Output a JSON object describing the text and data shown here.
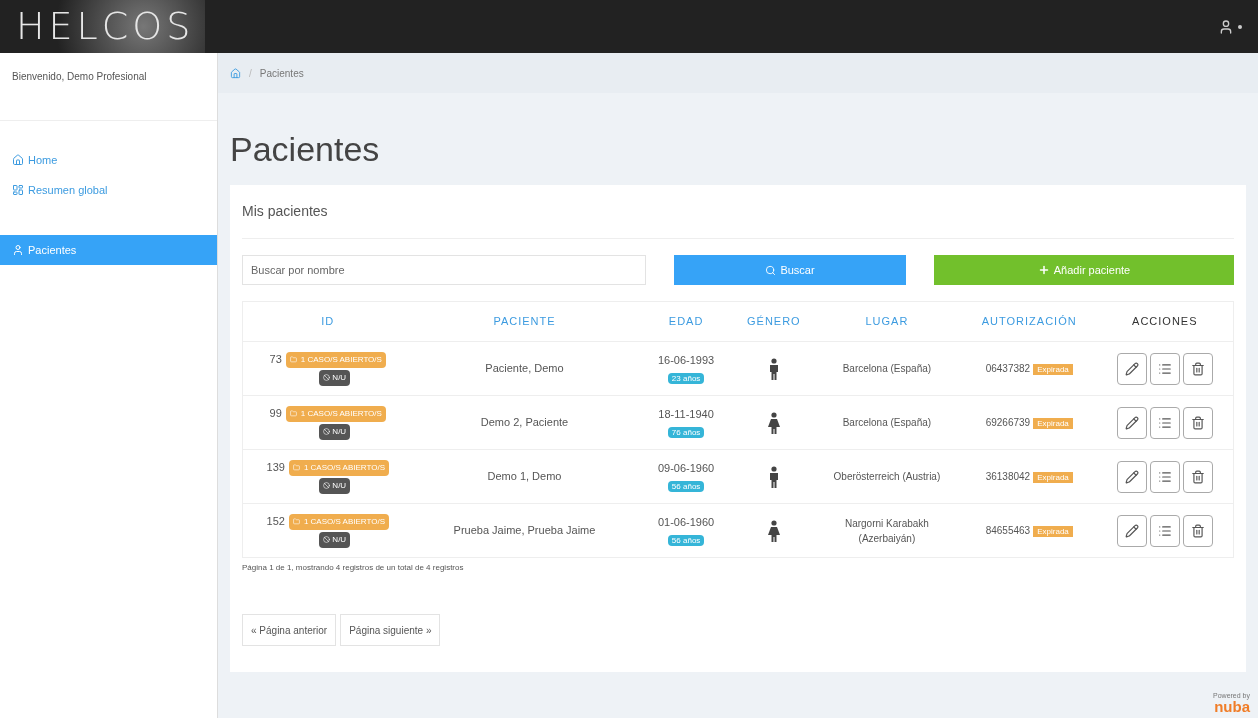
{
  "app": {
    "logo": "HELCOS"
  },
  "sidebar": {
    "welcome": "Bienvenido, Demo Profesional",
    "items": [
      {
        "label": "Home",
        "selected": false
      },
      {
        "label": "Resumen global",
        "selected": false
      },
      {
        "label": "Pacientes",
        "selected": true
      }
    ]
  },
  "breadcrumb": {
    "separator": "/",
    "items": [
      "Pacientes"
    ]
  },
  "page_title": "Pacientes",
  "card": {
    "title": "Mis pacientes",
    "search": {
      "placeholder": "Buscar por nombre"
    },
    "search_button": "Buscar",
    "add_button": "Añadir paciente",
    "table": {
      "columns": [
        {
          "label": "ID",
          "sortable": true
        },
        {
          "label": "PACIENTE",
          "sortable": true
        },
        {
          "label": "EDAD",
          "sortable": true
        },
        {
          "label": "GÉNERO",
          "sortable": true
        },
        {
          "label": "LUGAR",
          "sortable": true
        },
        {
          "label": "AUTORIZACIÓN",
          "sortable": true
        },
        {
          "label": "ACCIONES",
          "sortable": false
        }
      ],
      "rows": [
        {
          "id": "73",
          "cases": "1 CASO/S ABIERTO/S",
          "tag": "N/U",
          "patient": "Paciente, Demo",
          "date": "16-06-1993",
          "age": "23 años",
          "kind": "male",
          "place": "Barcelona (España)",
          "auth": "06437382",
          "auth_status": "Expirada"
        },
        {
          "id": "99",
          "cases": "1 CASO/S ABIERTO/S",
          "tag": "N/U",
          "patient": "Demo 2, Paciente",
          "date": "18-11-1940",
          "age": "76 años",
          "kind": "female",
          "place": "Barcelona (España)",
          "auth": "69266739",
          "auth_status": "Expirada"
        },
        {
          "id": "139",
          "cases": "1 CASO/S ABIERTO/S",
          "tag": "N/U",
          "patient": "Demo 1, Demo",
          "date": "09-06-1960",
          "age": "56 años",
          "kind": "male",
          "place": "Oberösterreich (Austria)",
          "auth": "36138042",
          "auth_status": "Expirada"
        },
        {
          "id": "152",
          "cases": "1 CASO/S ABIERTO/S",
          "tag": "N/U",
          "patient": "Prueba Jaime, Prueba Jaime",
          "date": "01-06-1960",
          "age": "56 años",
          "kind": "female",
          "place": "Nargorni Karabakh (Azerbaiyán)",
          "auth": "84655463",
          "auth_status": "Expirada"
        }
      ]
    },
    "summary": "Página 1 de 1, mostrando 4 registros de un total de 4 registros",
    "pager": [
      "« Página anterior",
      "Página siguiente »"
    ]
  },
  "footer": {
    "powered": "Powered by",
    "brand": "nuba"
  }
}
